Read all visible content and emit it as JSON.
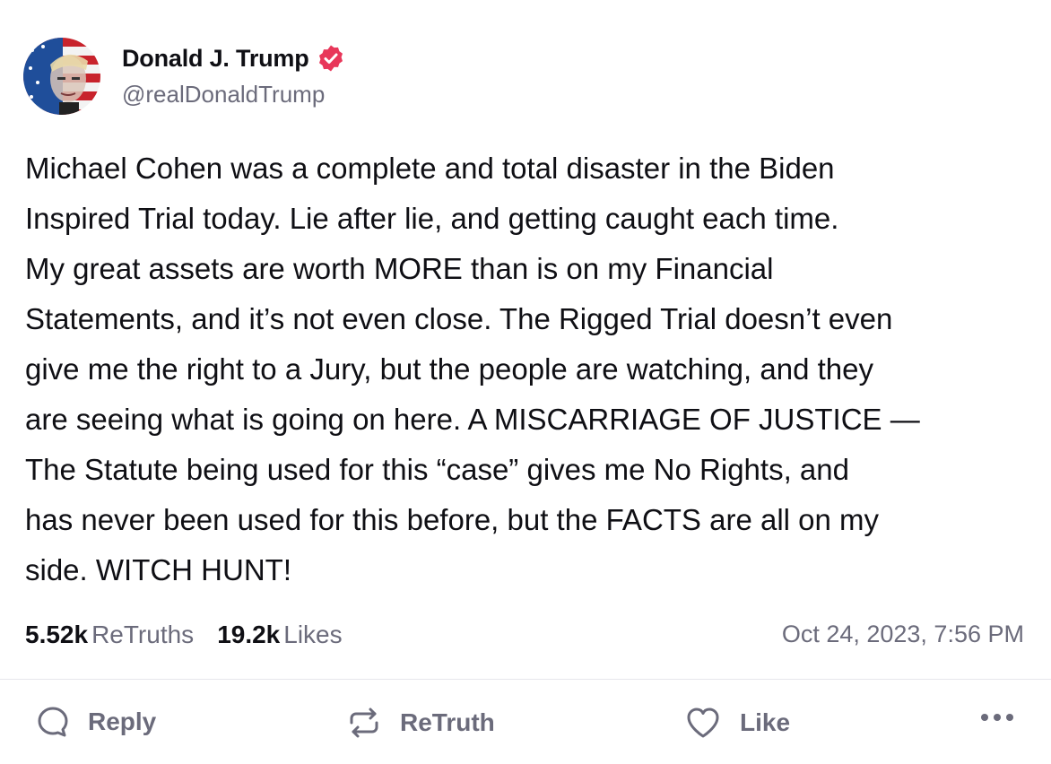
{
  "author": {
    "display_name": "Donald J. Trump",
    "handle": "@realDonaldTrump",
    "verified": true,
    "verified_color": "#e8375a",
    "avatar_icon": "user-avatar-flag"
  },
  "post": {
    "text": "Michael Cohen was a complete and total disaster in the Biden\nInspired Trial today. Lie after lie, and getting caught each time.\nMy great assets are worth MORE than is on my Financial\nStatements, and it’s not even close. The Rigged Trial doesn’t even\ngive me the right to a Jury, but the people are watching, and they\nare seeing what is going on here. A MISCARRIAGE OF JUSTICE —\nThe Statute being used for this “case” gives me No Rights, and\nhas never been used for this before, but the FACTS are all on my\nside. WITCH HUNT!",
    "timestamp": "Oct 24, 2023, 7:56 PM"
  },
  "stats": {
    "retruths_count": "5.52k",
    "retruths_label": "ReTruths",
    "likes_count": "19.2k",
    "likes_label": "Likes"
  },
  "actions": {
    "reply_label": "Reply",
    "retruth_label": "ReTruth",
    "like_label": "Like",
    "reply_icon": "reply-icon",
    "retruth_icon": "retruth-icon",
    "like_icon": "heart-icon",
    "more_icon": "more-options-icon"
  },
  "colors": {
    "text_primary": "#0f0f14",
    "text_secondary": "#6b6b7b",
    "divider": "#e6e6ec"
  }
}
